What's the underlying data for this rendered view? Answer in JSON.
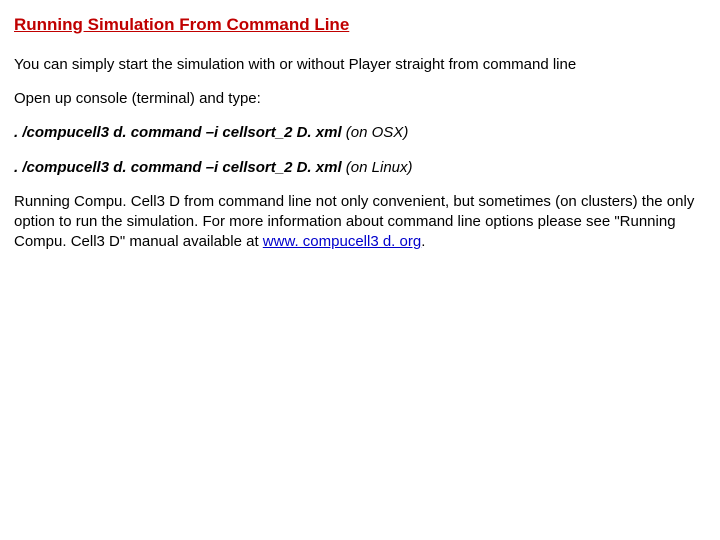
{
  "title": "Running Simulation From Command Line",
  "intro": "You can simply start the simulation with or without Player straight from command line",
  "open_console": "Open up console (terminal) and type:",
  "cmd_osx": ". /compucell3 d. command –i cellsort_2 D. xml",
  "hint_osx": "  (on OSX)",
  "cmd_linux": ". /compucell3 d. command –i cellsort_2 D. xml",
  "hint_linux": "  (on Linux)",
  "closing_a": "Running Compu. Cell3 D from command line not only convenient, but sometimes (on clusters) the only option to run the simulation. For more information about command line options please see \"Running Compu. Cell3 D\" manual available at ",
  "link": "www. compucell3 d. org",
  "closing_b": "."
}
